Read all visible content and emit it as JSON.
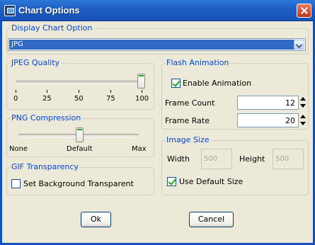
{
  "window": {
    "title": "Chart Options"
  },
  "display_option": {
    "label": "Display Chart Option",
    "selected": "JPG"
  },
  "jpeg_quality": {
    "label": "JPEG Quality",
    "ticks": [
      "0",
      "25",
      "50",
      "75",
      "100"
    ],
    "value": 100
  },
  "png_compression": {
    "label": "PNG Compression",
    "ticks": [
      "None",
      "Default",
      "Max"
    ],
    "value": "Default"
  },
  "gif_transparency": {
    "label": "GIF Transparency",
    "checkbox_label": "Set Background Transparent",
    "checked": false
  },
  "flash_animation": {
    "label": "Flash Animation",
    "enable_label": "Enable Animation",
    "enabled": true,
    "frame_count_label": "Frame Count",
    "frame_count": "12",
    "frame_rate_label": "Frame Rate",
    "frame_rate": "20"
  },
  "image_size": {
    "label": "Image Size",
    "width_label": "Width",
    "width_value": "500",
    "height_label": "Height",
    "height_value": "500",
    "default_size_label": "Use Default Size",
    "default_size_checked": true
  },
  "buttons": {
    "ok": "Ok",
    "cancel": "Cancel"
  }
}
